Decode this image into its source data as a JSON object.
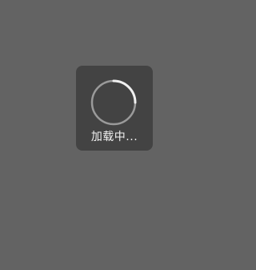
{
  "loading": {
    "label": "加载中...",
    "icon": "loading-spinner-icon"
  },
  "colors": {
    "overlay": "#636363",
    "toast_bg": "#434343",
    "spinner_track": "#9a9a9a",
    "spinner_arc": "#f0f0f0",
    "text": "#f2f2f2"
  }
}
